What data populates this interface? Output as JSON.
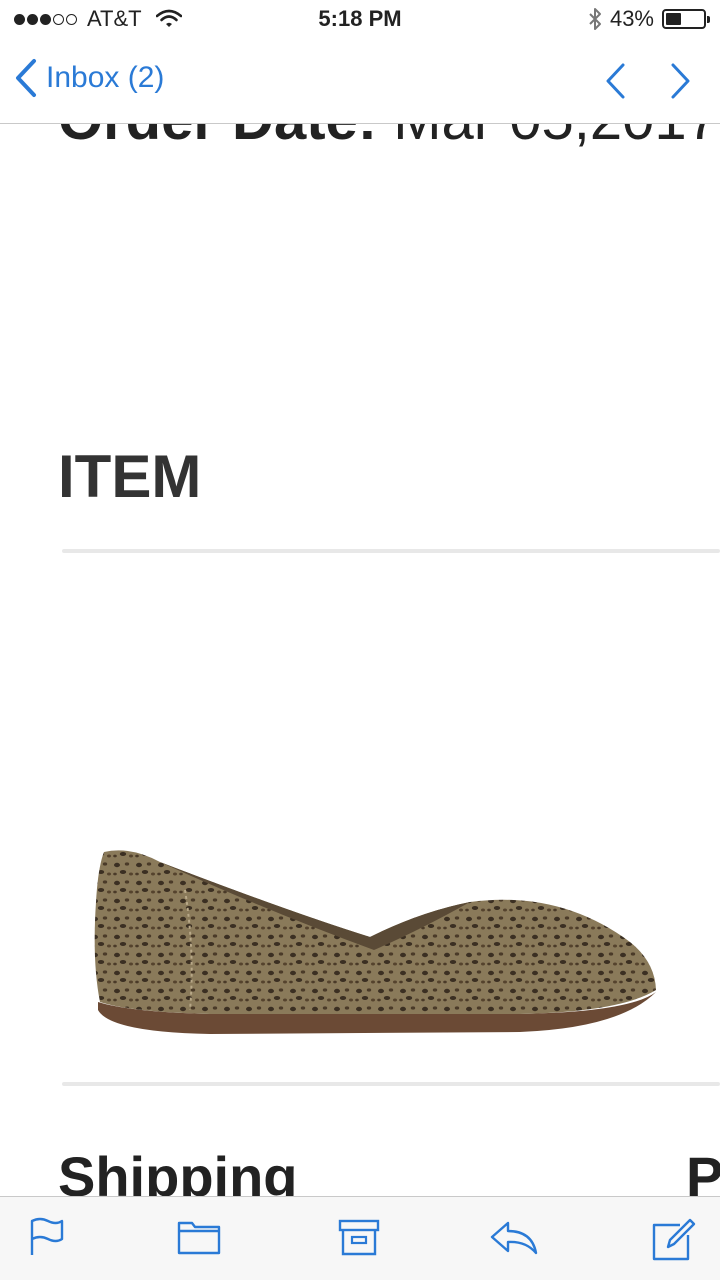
{
  "status_bar": {
    "signal_bars_filled": 3,
    "signal_bars_total": 5,
    "carrier": "AT&T",
    "time": "5:18 PM",
    "battery_percent": "43%",
    "battery_level": 0.43
  },
  "nav": {
    "back_label": "Inbox (2)",
    "accent_color": "#2a7ad6"
  },
  "email": {
    "order_date_label": "Order Date:",
    "order_date_value": "Mar 05,2017",
    "item_heading": "ITEM",
    "product_image": "leopard-print-flat-shoe",
    "shipping_heading": "Shipping",
    "second_column_heading": "P"
  },
  "toolbar": {
    "icons": [
      "flag-icon",
      "folder-icon",
      "archive-icon",
      "reply-icon",
      "compose-icon"
    ]
  }
}
